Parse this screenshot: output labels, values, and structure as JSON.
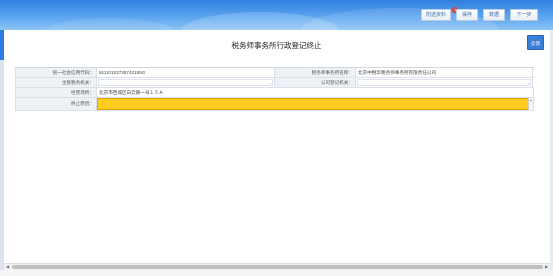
{
  "toolbar": {
    "buttons": [
      {
        "label": "附送资料"
      },
      {
        "label": "保存"
      },
      {
        "label": "数据"
      },
      {
        "label": "下一步"
      }
    ],
    "badge_count": "1"
  },
  "page": {
    "title": "税务师事务所行政登记终止",
    "side_button": "反馈"
  },
  "form": {
    "rows": [
      {
        "label1": "统一社会信用代码：",
        "value1": "91110102738742185G",
        "label2": "税务师事务所名称：",
        "value2": "北京中税华税务师事务所有限责任公司"
      },
      {
        "label1": "主管税务机关：",
        "value1": "",
        "label2": "公司登记机关：",
        "value2": ""
      },
      {
        "label1": "经营场所：",
        "value1": "北京市西城区白云路一号１５Ａ"
      },
      {
        "label1": "终止原因：",
        "value1": ""
      }
    ]
  },
  "colors": {
    "header_blue": "#2f7fe0",
    "required_field_yellow": "#ffcc1f",
    "button_blue": "#3a7fd6"
  }
}
